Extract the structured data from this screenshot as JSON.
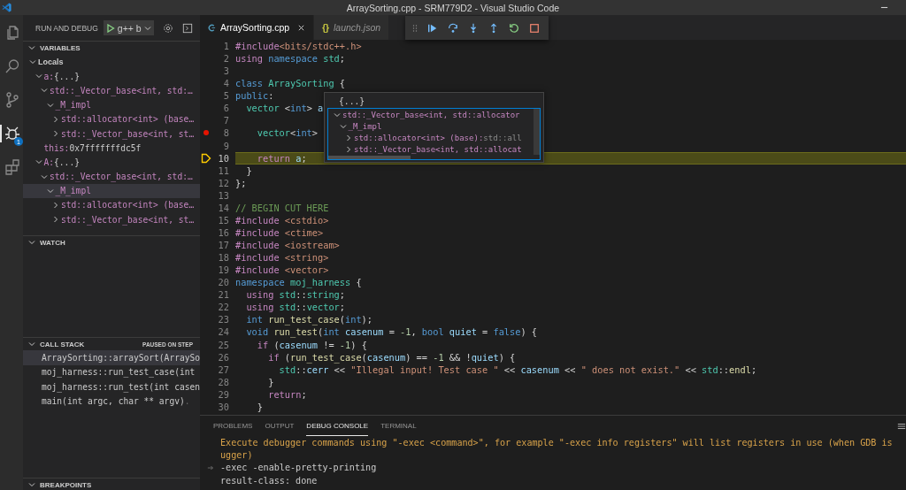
{
  "window": {
    "title": "ArraySorting.cpp - SRM779D2 - Visual Studio Code"
  },
  "activity_bar": [
    {
      "kind": "files",
      "selected": false
    },
    {
      "kind": "search",
      "selected": false
    },
    {
      "kind": "branch",
      "selected": false
    },
    {
      "kind": "debug",
      "selected": true,
      "badge": "1"
    },
    {
      "kind": "extensions",
      "selected": false
    }
  ],
  "sidebar": {
    "title": "RUN AND DEBUG",
    "config": "g++ b",
    "variables": {
      "title": "VARIABLES",
      "expanded": true,
      "tree": [
        {
          "kind": "scope",
          "name": "Locals",
          "expanded": true,
          "selected": false,
          "children": [
            {
              "kind": "var",
              "name": "a:",
              "value": "{...}",
              "expanded": true,
              "selected": false,
              "children": [
                {
                  "kind": "var",
                  "name": "std::_Vector_base<int, std:…",
                  "expanded": true,
                  "selected": false,
                  "children": [
                    {
                      "kind": "var",
                      "name": "_M_impl",
                      "expanded": true,
                      "selected": false,
                      "children": [
                        {
                          "kind": "var",
                          "name": "std::allocator<int> (base…",
                          "expanded": false,
                          "selected": false
                        },
                        {
                          "kind": "var",
                          "name": "std::_Vector_base<int, st…",
                          "expanded": false,
                          "selected": false
                        }
                      ]
                    }
                  ]
                }
              ]
            },
            {
              "kind": "leaf",
              "name": "this:",
              "value": "0x7fffffffdc5f",
              "selected": false
            },
            {
              "kind": "var",
              "name": "A:",
              "value": "{...}",
              "expanded": true,
              "selected": false,
              "children": [
                {
                  "kind": "var",
                  "name": "std::_Vector_base<int, std:…",
                  "expanded": true,
                  "selected": false,
                  "children": [
                    {
                      "kind": "var",
                      "name": "_M_impl",
                      "expanded": true,
                      "selected": true,
                      "children": [
                        {
                          "kind": "var",
                          "name": "std::allocator<int> (base…",
                          "expanded": false,
                          "selected": false
                        },
                        {
                          "kind": "var",
                          "name": "std::_Vector_base<int, st…",
                          "expanded": false,
                          "selected": false
                        }
                      ]
                    }
                  ]
                }
              ]
            }
          ]
        }
      ]
    },
    "watch": {
      "title": "WATCH",
      "expanded": true
    },
    "call_stack": {
      "title": "CALL STACK",
      "expanded": true,
      "status": "PAUSED ON STEP",
      "frames": [
        {
          "text": "ArraySorting::arraySort(ArraySo",
          "selected": true
        },
        {
          "text": "moj_harness::run_test_case(int",
          "selected": false
        },
        {
          "text": "moj_harness::run_test(int casen",
          "selected": false
        },
        {
          "text": "main(int argc, char ** argv)",
          "source": ".",
          "selected": false
        }
      ]
    },
    "breakpoints": {
      "title": "BREAKPOINTS",
      "expanded": true
    }
  },
  "tabs": [
    {
      "kind": "cpp",
      "label": "ArraySorting.cpp",
      "selected": true,
      "preview": false
    },
    {
      "kind": "json",
      "icon": "{}",
      "label": "launch.json",
      "selected": false,
      "preview": true
    }
  ],
  "debug_toolbar": [
    {
      "kind": "grip"
    },
    {
      "kind": "continue"
    },
    {
      "kind": "step-over"
    },
    {
      "kind": "step-into"
    },
    {
      "kind": "step-out"
    },
    {
      "kind": "restart"
    },
    {
      "kind": "stop"
    }
  ],
  "lines": [
    {
      "n": "1",
      "breakpoint": false,
      "current": false,
      "tokens": [
        {
          "kind": "pp",
          "text": "#include"
        },
        {
          "kind": "str",
          "text": "<bits/stdc++.h>"
        }
      ]
    },
    {
      "n": "2",
      "breakpoint": false,
      "current": false,
      "tokens": [
        {
          "kind": "ctl",
          "text": "using "
        },
        {
          "kind": "kw",
          "text": "namespace "
        },
        {
          "kind": "type",
          "text": "std"
        },
        {
          "kind": "p",
          "text": ";"
        }
      ]
    },
    {
      "n": "3",
      "breakpoint": false,
      "current": false
    },
    {
      "n": "4",
      "breakpoint": false,
      "current": false,
      "tokens": [
        {
          "kind": "kw",
          "text": "class "
        },
        {
          "kind": "type",
          "text": "ArraySorting"
        },
        {
          "kind": "p",
          "text": " {"
        }
      ]
    },
    {
      "n": "5",
      "breakpoint": false,
      "current": false,
      "tokens": [
        {
          "kind": "kw",
          "text": "public"
        },
        {
          "kind": "p",
          "text": ":"
        }
      ]
    },
    {
      "n": "6",
      "breakpoint": false,
      "current": false,
      "tokens": [
        {
          "kind": "type",
          "text": "  vector"
        },
        {
          "kind": "p",
          "text": " <"
        },
        {
          "kind": "kw",
          "text": "int"
        },
        {
          "kind": "p",
          "text": "> "
        },
        {
          "kind": "var",
          "text": "a"
        }
      ]
    },
    {
      "n": "7",
      "breakpoint": false,
      "current": false
    },
    {
      "n": "8",
      "breakpoint": true,
      "current": false,
      "tokens": [
        {
          "kind": "type",
          "text": "    vector"
        },
        {
          "kind": "p",
          "text": "<"
        },
        {
          "kind": "kw",
          "text": "int"
        },
        {
          "kind": "p",
          "text": ">"
        }
      ]
    },
    {
      "n": "9",
      "breakpoint": false,
      "current": false
    },
    {
      "n": "10",
      "breakpoint": false,
      "current": true,
      "tokens": [
        {
          "kind": "ctl",
          "text": "    return "
        },
        {
          "kind": "var",
          "text": "a"
        },
        {
          "kind": "p",
          "text": ";"
        }
      ]
    },
    {
      "n": "11",
      "breakpoint": false,
      "current": false,
      "tokens": [
        {
          "kind": "p",
          "text": "  }"
        }
      ]
    },
    {
      "n": "12",
      "breakpoint": false,
      "current": false,
      "tokens": [
        {
          "kind": "p",
          "text": "};"
        }
      ]
    },
    {
      "n": "13",
      "breakpoint": false,
      "current": false
    },
    {
      "n": "14",
      "breakpoint": false,
      "current": false,
      "tokens": [
        {
          "kind": "com",
          "text": "// BEGIN CUT HERE"
        }
      ]
    },
    {
      "n": "15",
      "breakpoint": false,
      "current": false,
      "tokens": [
        {
          "kind": "pp",
          "text": "#include "
        },
        {
          "kind": "str",
          "text": "<cstdio>"
        }
      ]
    },
    {
      "n": "16",
      "breakpoint": false,
      "current": false,
      "tokens": [
        {
          "kind": "pp",
          "text": "#include "
        },
        {
          "kind": "str",
          "text": "<ctime>"
        }
      ]
    },
    {
      "n": "17",
      "breakpoint": false,
      "current": false,
      "tokens": [
        {
          "kind": "pp",
          "text": "#include "
        },
        {
          "kind": "str",
          "text": "<iostream>"
        }
      ]
    },
    {
      "n": "18",
      "breakpoint": false,
      "current": false,
      "tokens": [
        {
          "kind": "pp",
          "text": "#include "
        },
        {
          "kind": "str",
          "text": "<string>"
        }
      ]
    },
    {
      "n": "19",
      "breakpoint": false,
      "current": false,
      "tokens": [
        {
          "kind": "pp",
          "text": "#include "
        },
        {
          "kind": "str",
          "text": "<vector>"
        }
      ]
    },
    {
      "n": "20",
      "breakpoint": false,
      "current": false,
      "tokens": [
        {
          "kind": "kw",
          "text": "namespace "
        },
        {
          "kind": "type",
          "text": "moj_harness"
        },
        {
          "kind": "p",
          "text": " {"
        }
      ]
    },
    {
      "n": "21",
      "breakpoint": false,
      "current": false,
      "tokens": [
        {
          "kind": "ctl",
          "text": "  using "
        },
        {
          "kind": "type",
          "text": "std"
        },
        {
          "kind": "p",
          "text": "::"
        },
        {
          "kind": "type",
          "text": "string"
        },
        {
          "kind": "p",
          "text": ";"
        }
      ]
    },
    {
      "n": "22",
      "breakpoint": false,
      "current": false,
      "tokens": [
        {
          "kind": "ctl",
          "text": "  using "
        },
        {
          "kind": "type",
          "text": "std"
        },
        {
          "kind": "p",
          "text": "::"
        },
        {
          "kind": "type",
          "text": "vector"
        },
        {
          "kind": "p",
          "text": ";"
        }
      ]
    },
    {
      "n": "23",
      "breakpoint": false,
      "current": false,
      "tokens": [
        {
          "kind": "kw",
          "text": "  int "
        },
        {
          "kind": "fn",
          "text": "run_test_case"
        },
        {
          "kind": "p",
          "text": "("
        },
        {
          "kind": "kw",
          "text": "int"
        },
        {
          "kind": "p",
          "text": ");"
        }
      ]
    },
    {
      "n": "24",
      "breakpoint": false,
      "current": false,
      "tokens": [
        {
          "kind": "kw",
          "text": "  void "
        },
        {
          "kind": "fn",
          "text": "run_test"
        },
        {
          "kind": "p",
          "text": "("
        },
        {
          "kind": "kw",
          "text": "int "
        },
        {
          "kind": "var",
          "text": "casenum"
        },
        {
          "kind": "p",
          "text": " = "
        },
        {
          "kind": "num",
          "text": "-1"
        },
        {
          "kind": "p",
          "text": ", "
        },
        {
          "kind": "kw",
          "text": "bool "
        },
        {
          "kind": "var",
          "text": "quiet"
        },
        {
          "kind": "p",
          "text": " = "
        },
        {
          "kind": "kw",
          "text": "false"
        },
        {
          "kind": "p",
          "text": ") {"
        }
      ]
    },
    {
      "n": "25",
      "breakpoint": false,
      "current": false,
      "tokens": [
        {
          "kind": "ctl",
          "text": "    if"
        },
        {
          "kind": "p",
          "text": " ("
        },
        {
          "kind": "var",
          "text": "casenum"
        },
        {
          "kind": "p",
          "text": " != "
        },
        {
          "kind": "num",
          "text": "-1"
        },
        {
          "kind": "p",
          "text": ") {"
        }
      ]
    },
    {
      "n": "26",
      "breakpoint": false,
      "current": false,
      "tokens": [
        {
          "kind": "ctl",
          "text": "      if"
        },
        {
          "kind": "p",
          "text": " ("
        },
        {
          "kind": "fn",
          "text": "run_test_case"
        },
        {
          "kind": "p",
          "text": "("
        },
        {
          "kind": "var",
          "text": "casenum"
        },
        {
          "kind": "p",
          "text": ") == "
        },
        {
          "kind": "num",
          "text": "-1"
        },
        {
          "kind": "p",
          "text": " && !"
        },
        {
          "kind": "var",
          "text": "quiet"
        },
        {
          "kind": "p",
          "text": ") {"
        }
      ]
    },
    {
      "n": "27",
      "breakpoint": false,
      "current": false,
      "tokens": [
        {
          "kind": "type",
          "text": "        std"
        },
        {
          "kind": "p",
          "text": "::"
        },
        {
          "kind": "var",
          "text": "cerr"
        },
        {
          "kind": "p",
          "text": " << "
        },
        {
          "kind": "str",
          "text": "\"Illegal input! Test case \""
        },
        {
          "kind": "p",
          "text": " << "
        },
        {
          "kind": "var",
          "text": "casenum"
        },
        {
          "kind": "p",
          "text": " << "
        },
        {
          "kind": "str",
          "text": "\" does not exist.\""
        },
        {
          "kind": "p",
          "text": " << "
        },
        {
          "kind": "type",
          "text": "std"
        },
        {
          "kind": "p",
          "text": "::"
        },
        {
          "kind": "fn",
          "text": "endl"
        },
        {
          "kind": "p",
          "text": ";"
        }
      ]
    },
    {
      "n": "28",
      "breakpoint": false,
      "current": false,
      "tokens": [
        {
          "kind": "p",
          "text": "      }"
        }
      ]
    },
    {
      "n": "29",
      "breakpoint": false,
      "current": false,
      "tokens": [
        {
          "kind": "ctl",
          "text": "      return"
        },
        {
          "kind": "p",
          "text": ";"
        }
      ]
    },
    {
      "n": "30",
      "breakpoint": false,
      "current": false,
      "tokens": [
        {
          "kind": "p",
          "text": "    }"
        }
      ]
    }
  ],
  "hover": {
    "header": "{...}",
    "tree": [
      {
        "name": "std::_Vector_base<int, std::allocator",
        "expanded": true,
        "children": [
          {
            "name": "_M_impl",
            "expanded": true,
            "children": [
              {
                "name": "std::allocator<int> (base):",
                "value": "std::all",
                "expanded": false
              },
              {
                "name": "std::_Vector_base<int, std::allocat",
                "expanded": false
              }
            ]
          }
        ]
      }
    ]
  },
  "panel": {
    "tabs": [
      {
        "label": "PROBLEMS",
        "selected": false
      },
      {
        "label": "OUTPUT",
        "selected": false
      },
      {
        "label": "DEBUG CONSOLE",
        "selected": true
      },
      {
        "label": "TERMINAL",
        "selected": false
      }
    ],
    "console": [
      {
        "kind": "warning",
        "text": "Execute debugger commands using \"-exec <command>\", for example \"-exec info registers\" will list registers in use (when GDB is"
      },
      {
        "kind": "warning",
        "text": "ugger)"
      },
      {
        "kind": "input",
        "text": "-exec -enable-pretty-printing"
      },
      {
        "kind": "output",
        "text": "result-class: done"
      }
    ]
  }
}
